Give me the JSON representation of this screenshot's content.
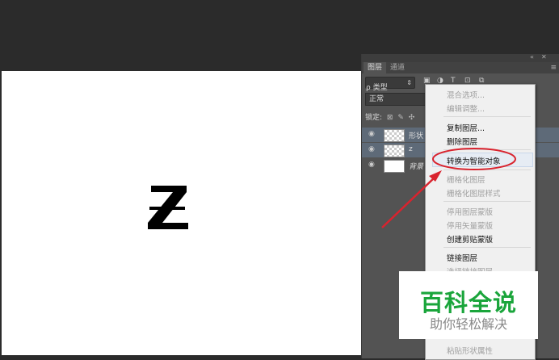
{
  "panel": {
    "collapse_glyph": "«",
    "close_glyph": "✕",
    "tabs": [
      "图层",
      "通道"
    ],
    "menu_glyph": "≡",
    "filter_label": "ρ 类型",
    "filter_icons": [
      "image-icon",
      "adjust-icon",
      "text-icon",
      "shape-icon",
      "smart-object-icon"
    ],
    "blend_mode": "正常",
    "lock_label": "锁定:",
    "layers": [
      {
        "name": "形状",
        "thumb": "checker",
        "selected": true
      },
      {
        "name": "z",
        "thumb": "checker",
        "selected": true
      },
      {
        "name": "背景",
        "thumb": "white",
        "selected": false
      }
    ]
  },
  "canvas": {
    "letter": "Z"
  },
  "context_menu": {
    "items": [
      {
        "label": "混合选项...",
        "disabled": true
      },
      {
        "label": "编辑调整...",
        "disabled": true
      },
      {
        "label": "复制图层...",
        "disabled": false
      },
      {
        "label": "删除图层",
        "disabled": false
      },
      {
        "label": "转换为智能对象",
        "disabled": false
      },
      {
        "label": "栅格化图层",
        "disabled": true
      },
      {
        "label": "栅格化图层样式",
        "disabled": true
      },
      {
        "label": "停用图层蒙版",
        "disabled": true
      },
      {
        "label": "停用矢量蒙版",
        "disabled": true
      },
      {
        "label": "创建剪贴蒙版",
        "disabled": false
      },
      {
        "label": "链接图层",
        "disabled": false
      },
      {
        "label": "选择链接图层",
        "disabled": true
      },
      {
        "label": "粘贴形状属性",
        "disabled": true
      }
    ]
  },
  "watermark": {
    "main": "百科全说",
    "sub": "助你轻松解决"
  },
  "colors": {
    "annotation": "#d9232e",
    "watermark_green": "#1aa53b"
  }
}
